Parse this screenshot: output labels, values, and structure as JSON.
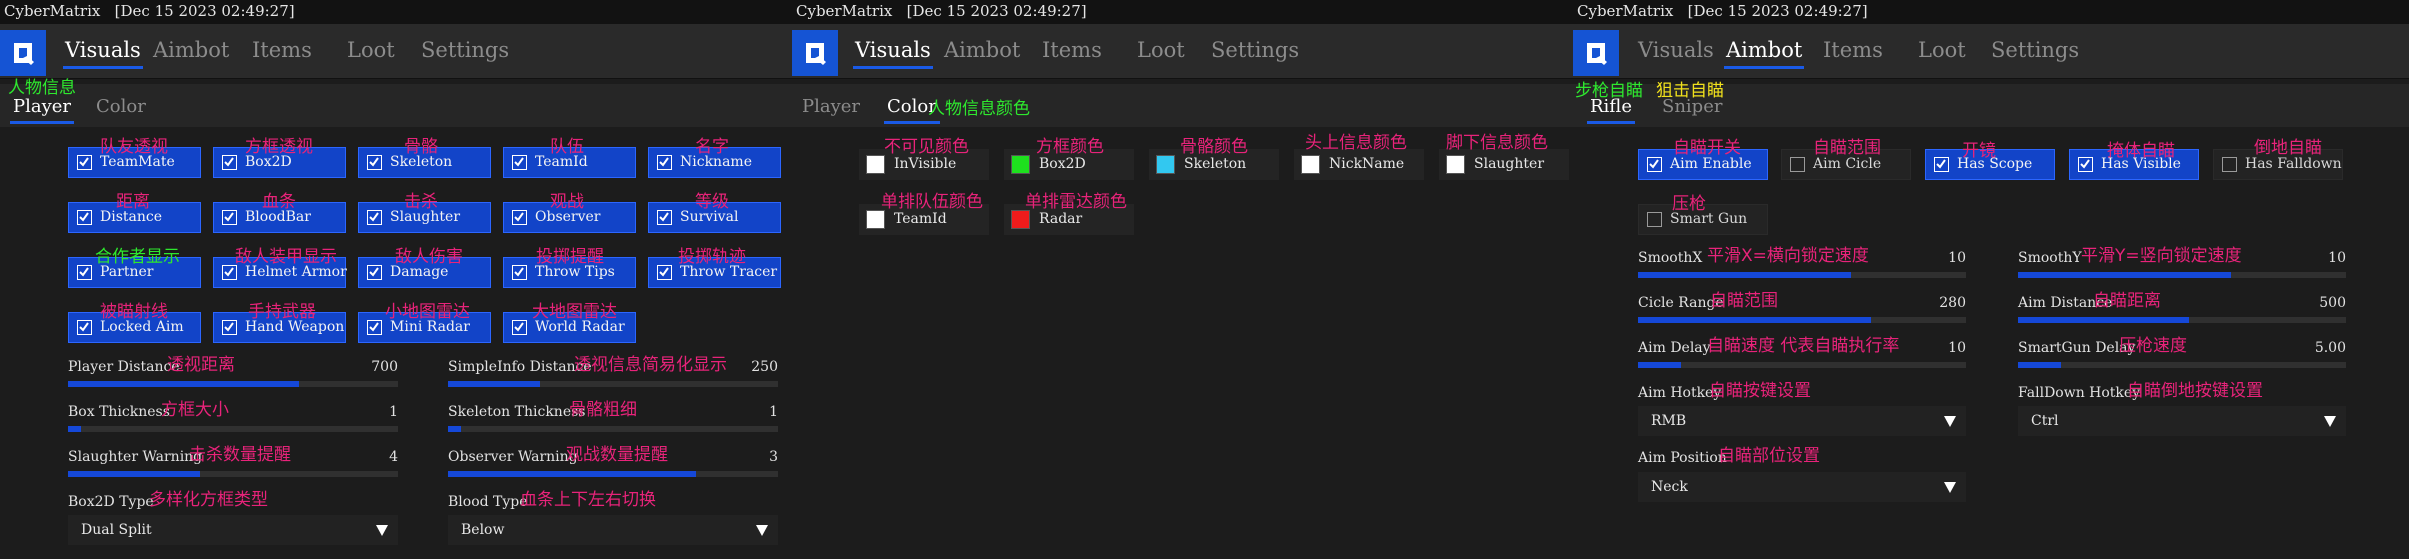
{
  "panels": [
    {
      "app_name": "CyberMatrix",
      "timestamp": "[Dec 15 2023 02:49:27]",
      "tabs": [
        "Visuals",
        "Aimbot",
        "Items",
        "Loot",
        "Settings"
      ],
      "active_tab": "Visuals",
      "subtabs": [
        "Player",
        "Color"
      ],
      "active_subtab": "Player",
      "annotations": {
        "header": "人物信息",
        "teammate": "队友透视",
        "box2d": "方框透视",
        "skeleton": "骨骼",
        "teamid": "队伍",
        "nickname": "名字",
        "distance": "距离",
        "bloodbar": "血条",
        "slaughter": "击杀",
        "observer": "观战",
        "survival": "等级",
        "partner": "合作者显示",
        "helmet": "敌人装甲显示",
        "damage": "敌人伤害",
        "throw_tips": "投掷提醒",
        "throw_tracer": "投掷轨迹",
        "locked_aim": "被瞄射线",
        "hand_weapon": "手持武器",
        "mini_radar": "小地图雷达",
        "world_radar": "大地图雷达",
        "player_distance": "透视距离",
        "simpleinfo": "透视信息简易化显示",
        "box_thickness": "方框大小",
        "skeleton_thickness": "骨骼粗细",
        "slaughter_warning": "击杀数量提醒",
        "observer_warning": "观战数量提醒",
        "box2d_type": "多样化方框类型",
        "blood_type": "血条上下左右切换"
      },
      "checkboxes": [
        {
          "label": "TeamMate",
          "checked": true
        },
        {
          "label": "Box2D",
          "checked": true
        },
        {
          "label": "Skeleton",
          "checked": true
        },
        {
          "label": "TeamId",
          "checked": true
        },
        {
          "label": "Nickname",
          "checked": true
        },
        {
          "label": "Distance",
          "checked": true
        },
        {
          "label": "BloodBar",
          "checked": true
        },
        {
          "label": "Slaughter",
          "checked": true
        },
        {
          "label": "Observer",
          "checked": true
        },
        {
          "label": "Survival",
          "checked": true
        },
        {
          "label": "Partner",
          "checked": true
        },
        {
          "label": "Helmet Armor",
          "checked": true
        },
        {
          "label": "Damage",
          "checked": true
        },
        {
          "label": "Throw Tips",
          "checked": true
        },
        {
          "label": "Throw Tracer",
          "checked": true
        },
        {
          "label": "Locked Aim",
          "checked": true
        },
        {
          "label": "Hand Weapon",
          "checked": true
        },
        {
          "label": "Mini Radar",
          "checked": true
        },
        {
          "label": "World Radar",
          "checked": true
        }
      ],
      "sliders": [
        {
          "label": "Player Distance",
          "value": "700",
          "fill": 0.7
        },
        {
          "label": "SimpleInfo Distance",
          "value": "250",
          "fill": 0.28
        },
        {
          "label": "Box Thickness",
          "value": "1",
          "fill": 0.04
        },
        {
          "label": "Skeleton Thickness",
          "value": "1",
          "fill": 0.04
        },
        {
          "label": "Slaughter Warning",
          "value": "4",
          "fill": 0.4
        },
        {
          "label": "Observer Warning",
          "value": "3",
          "fill": 0.75
        }
      ],
      "selects": [
        {
          "label": "Box2D Type",
          "value": "Dual Split"
        },
        {
          "label": "Blood Type",
          "value": "Below"
        }
      ]
    },
    {
      "app_name": "CyberMatrix",
      "timestamp": "[Dec 15 2023 02:49:27]",
      "tabs": [
        "Visuals",
        "Aimbot",
        "Items",
        "Loot",
        "Settings"
      ],
      "active_tab": "Visuals",
      "subtabs": [
        "Player",
        "Color"
      ],
      "active_subtab": "Color",
      "annotations": {
        "header": "人物信息颜色",
        "invisible": "不可见颜色",
        "box2d": "方框颜色",
        "skeleton": "骨骼颜色",
        "nickname": "头上信息颜色",
        "slaughter": "脚下信息颜色",
        "teamid": "单排队伍颜色",
        "radar": "单排雷达颜色"
      },
      "colors": [
        {
          "label": "InVisible",
          "swatch": "#ffffff"
        },
        {
          "label": "Box2D",
          "swatch": "#1ee01e"
        },
        {
          "label": "Skeleton",
          "swatch": "#32c8f0"
        },
        {
          "label": "NickName",
          "swatch": "#ffffff"
        },
        {
          "label": "Slaughter",
          "swatch": "#ffffff"
        },
        {
          "label": "TeamId",
          "swatch": "#ffffff"
        },
        {
          "label": "Radar",
          "swatch": "#ee1c1c"
        }
      ]
    },
    {
      "app_name": "CyberMatrix",
      "timestamp": "[Dec 15 2023 02:49:27]",
      "tabs": [
        "Visuals",
        "Aimbot",
        "Items",
        "Loot",
        "Settings"
      ],
      "active_tab": "Aimbot",
      "subtabs": [
        "Rifle",
        "Sniper"
      ],
      "active_subtab": "Rifle",
      "annotations": {
        "rifle": "步枪自瞄",
        "sniper": "狙击自瞄",
        "aim_enable": "自瞄开关",
        "aim_circle": "自瞄范围",
        "has_scope": "开镜",
        "has_visible": "掩体自瞄",
        "has_falldown": "倒地自瞄",
        "smart_gun": "压枪",
        "smoothx": "平滑X=横向锁定速度",
        "smoothy": "平滑Y=竖向锁定速度",
        "cicle_range": "自瞄范围",
        "aim_distance": "自瞄距离",
        "aim_delay": "自瞄速度 代表自瞄执行率",
        "smartgun_delay": "压枪速度",
        "aim_hotkey": "自瞄按键设置",
        "falldown_hotkey": "自瞄倒地按键设置",
        "aim_position": "自瞄部位设置"
      },
      "checkboxes": [
        {
          "label": "Aim Enable",
          "checked": true
        },
        {
          "label": "Aim Cicle",
          "checked": false
        },
        {
          "label": "Has Scope",
          "checked": true
        },
        {
          "label": "Has Visible",
          "checked": true
        },
        {
          "label": "Has Falldown",
          "checked": false
        },
        {
          "label": "Smart Gun",
          "checked": false
        }
      ],
      "sliders": [
        {
          "label": "SmoothX",
          "value": "10",
          "fill": 0.65
        },
        {
          "label": "SmoothY",
          "value": "10",
          "fill": 0.65
        },
        {
          "label": "Cicle Range",
          "value": "280",
          "fill": 0.71
        },
        {
          "label": "Aim Distance",
          "value": "500",
          "fill": 0.52
        },
        {
          "label": "Aim Delay",
          "value": "10",
          "fill": 0.13
        },
        {
          "label": "SmartGun Delay",
          "value": "5.00",
          "fill": 0.13
        }
      ],
      "selects": [
        {
          "label": "Aim Hotkey",
          "value": "RMB"
        },
        {
          "label": "FallDown Hotkey",
          "value": "Ctrl"
        },
        {
          "label": "Aim Position",
          "value": "Neck"
        }
      ]
    }
  ]
}
